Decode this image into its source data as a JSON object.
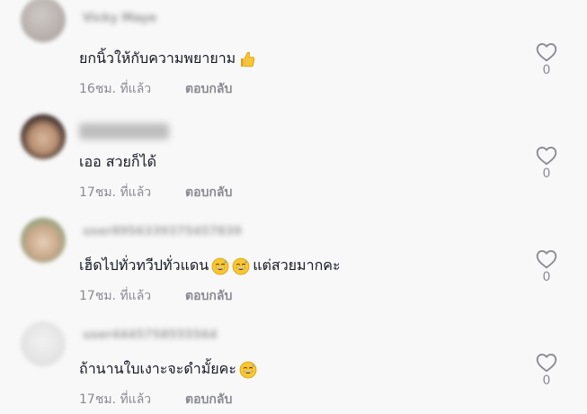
{
  "comments": [
    {
      "username": "Vicky Maye",
      "text": "ยกนิ้วให้กับความพยายาม",
      "emoji": "thumbs-up-icon",
      "time": "16ชม. ที่แล้ว",
      "reply_label": "ตอบกลับ",
      "likes": "0"
    },
    {
      "username": "",
      "text": "เออ สวยก็ได้",
      "time": "17ชม. ที่แล้ว",
      "reply_label": "ตอบกลับ",
      "likes": "0"
    },
    {
      "username": "user8956339375457839",
      "text_before": "เฮ็ดไปทั่วทวีปทั่วแดน",
      "text_after": "แต่สวยมากคะ",
      "emoji": "grinning-sweat-face-icon",
      "time": "17ชม. ที่แล้ว",
      "reply_label": "ตอบกลับ",
      "likes": "0"
    },
    {
      "username": "user4445758555564",
      "text": "ถ้านานใบเงาะจะดำมั้ยคะ",
      "emoji": "grinning-sweat-face-icon",
      "time": "17ชม. ที่แล้ว",
      "reply_label": "ตอบกลับ",
      "likes": "0"
    }
  ],
  "colors": {
    "background": "#f8f8f8",
    "text": "#161823",
    "secondary": "#8a8b91"
  }
}
